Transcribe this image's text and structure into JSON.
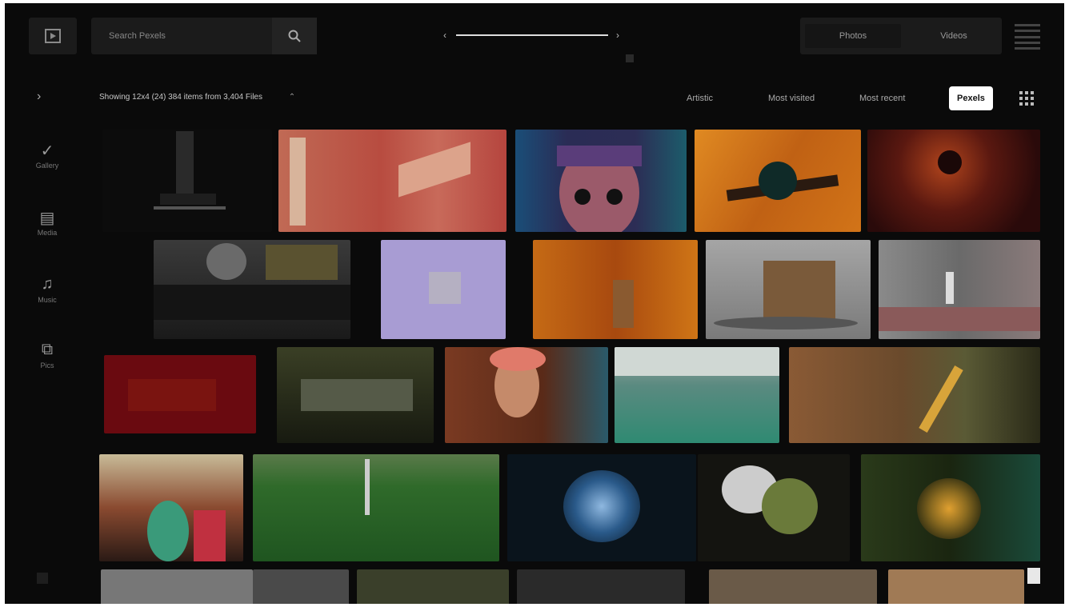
{
  "header": {
    "logo_icon": "play-square-icon",
    "search_placeholder": "Search Pexels",
    "search_icon": "search-icon",
    "scrubber_left": "‹",
    "scrubber_right": "›",
    "toggle": [
      "Photos",
      "Videos"
    ],
    "menu_icon": "hamburger-icon"
  },
  "filters": {
    "expander": "›",
    "summary": "Showing 12x4 (24) 384 items from 3,404 Files",
    "summary_chevron": "⌃",
    "sort_options": [
      "Artistic",
      "Most visited",
      "Most recent",
      "Pexels"
    ],
    "selected_sort": "Pexels",
    "grid_icon": "grid-icon"
  },
  "sidebar": [
    {
      "icon": "✓",
      "label": "Gallery"
    },
    {
      "icon": "▤",
      "label": "Media"
    },
    {
      "icon": "♫",
      "label": "Music"
    },
    {
      "icon": "⧉",
      "label": "Pics"
    }
  ],
  "colors": {
    "background": "#0a0a0a",
    "selected_button": "#ffffff"
  },
  "thumbnails": [
    {
      "kind": "pier",
      "base": "#0c0c0c"
    },
    {
      "kind": "pink wall",
      "base": "#b9584a"
    },
    {
      "kind": "face",
      "base": "#3a2f5a"
    },
    {
      "kind": "orange",
      "base": "#c5661c"
    },
    {
      "kind": "dark red",
      "base": "#3a0f0c"
    },
    {
      "kind": "camera",
      "base": "#2a2a2a"
    },
    {
      "kind": "lavender",
      "base": "#a79bd0"
    },
    {
      "kind": "wood",
      "base": "#b15a15"
    },
    {
      "kind": "table",
      "base": "#8c8c8c"
    },
    {
      "kind": "street",
      "base": "#7d7273"
    },
    {
      "kind": "red",
      "base": "#6b0a10"
    },
    {
      "kind": "camera2",
      "base": "#26291d"
    },
    {
      "kind": "portrait",
      "base": "#6e3622"
    },
    {
      "kind": "hallway",
      "base": "#3f7a6a"
    },
    {
      "kind": "bottles",
      "base": "#6b4a2c"
    },
    {
      "kind": "woman",
      "base": "#5c6b48"
    },
    {
      "kind": "field",
      "base": "#2d6a2b"
    },
    {
      "kind": "blue light",
      "base": "#0c1f2f"
    },
    {
      "kind": "plant",
      "base": "#3a3a2a"
    },
    {
      "kind": "sparkler",
      "base": "#1e2a12"
    },
    {
      "kind": "row5a",
      "base": "#777"
    },
    {
      "kind": "row5b",
      "base": "#3a3f2a"
    },
    {
      "kind": "row5c",
      "base": "#2a2a2a"
    },
    {
      "kind": "row5d",
      "base": "#6a5a48"
    },
    {
      "kind": "row5e",
      "base": "#a07a55"
    }
  ]
}
